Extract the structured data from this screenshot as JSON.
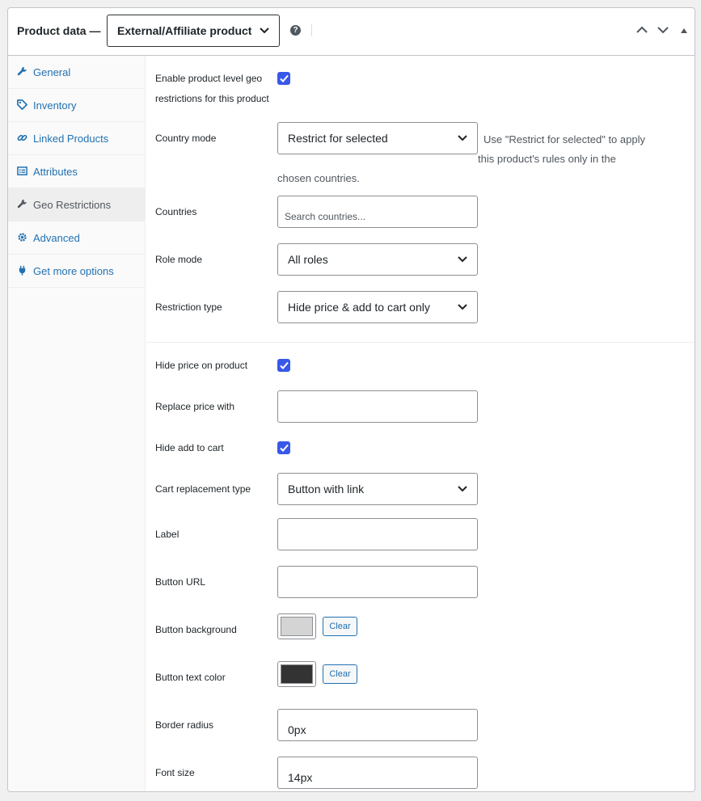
{
  "header": {
    "title": "Product data —",
    "product_type": "External/Affiliate product",
    "help_icon": "?"
  },
  "sidebar": {
    "items": [
      {
        "label": "General",
        "icon": "wrench-icon"
      },
      {
        "label": "Inventory",
        "icon": "tag-icon"
      },
      {
        "label": "Linked Products",
        "icon": "link-icon"
      },
      {
        "label": "Attributes",
        "icon": "list-icon"
      },
      {
        "label": "Geo Restrictions",
        "icon": "wrench-icon",
        "active": true
      },
      {
        "label": "Advanced",
        "icon": "gear-icon"
      },
      {
        "label": "Get more options",
        "icon": "plugin-icon"
      }
    ]
  },
  "form": {
    "enable_label_1": "Enable product level geo",
    "enable_label_2": "restrictions for this product",
    "enable_checked": true,
    "country_mode_label": "Country mode",
    "country_mode_value": "Restrict for selected",
    "country_mode_hint_1": "Use \"Restrict for selected\" to apply",
    "country_mode_hint_2": "this product's rules only in the",
    "country_mode_hint_3": "chosen countries.",
    "countries_label": "Countries",
    "countries_placeholder": "Search countries...",
    "role_mode_label": "Role mode",
    "role_mode_value": "All roles",
    "restriction_type_label": "Restriction type",
    "restriction_type_value": "Hide price & add to cart only",
    "hide_price_label": "Hide price on product",
    "hide_price_checked": true,
    "replace_price_label": "Replace price with",
    "replace_price_value": "",
    "hide_cart_label": "Hide add to cart",
    "hide_cart_checked": true,
    "cart_replacement_label": "Cart replacement type",
    "cart_replacement_value": "Button with link",
    "label_label": "Label",
    "label_value": "",
    "button_url_label": "Button URL",
    "button_url_value": "",
    "button_bg_label": "Button background",
    "button_bg_color": "#d4d4d4",
    "button_text_color_label": "Button text color",
    "button_text_color": "#333333",
    "clear_label": "Clear",
    "border_radius_label": "Border radius",
    "border_radius_value": "0px",
    "font_size_label": "Font size",
    "font_size_value": "14px"
  },
  "colors": {
    "accent": "#2271b1",
    "checkbox": "#3858e9"
  }
}
